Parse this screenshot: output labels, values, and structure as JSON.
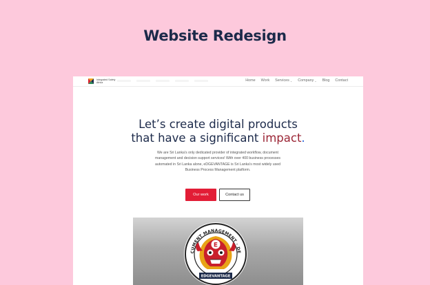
{
  "page_title": "Website Redesign",
  "site": {
    "logo": {
      "line1": "Integrated Safety",
      "line2": "Africa"
    },
    "nav": [
      {
        "label": "Home",
        "has_dropdown": false
      },
      {
        "label": "Work",
        "has_dropdown": false
      },
      {
        "label": "Services",
        "has_dropdown": true
      },
      {
        "label": "Company",
        "has_dropdown": true
      },
      {
        "label": "Blog",
        "has_dropdown": false
      },
      {
        "label": "Contact",
        "has_dropdown": false
      }
    ],
    "hero": {
      "heading_line1": "Let’s create digital products",
      "heading_line2_prefix": "that have a significant ",
      "heading_accent": "impact",
      "heading_dot": ".",
      "body": "We are Sri Lanka’s only dedicated provider of integrated workflow, document management and decision support services! With over 400 business processes automated in Sri Lanka alone, eDGEVANTAGE is Sri Lanka’s most widely used Business Process Management platform.",
      "primary_button": "Our work",
      "secondary_button": "Contact us"
    },
    "showcase": {
      "ring_text": "WORKFLOW · DOCUMENT MANAGEMENT · DECISION SUPPORT",
      "banner_text": "EDGEVANTAGE",
      "emblem_letter": "E"
    }
  },
  "colors": {
    "background": "#fdc9dc",
    "title": "#1c2a4a",
    "accent": "#9b2535",
    "primary_button": "#e21d36",
    "dot": "#1f5ed6"
  }
}
